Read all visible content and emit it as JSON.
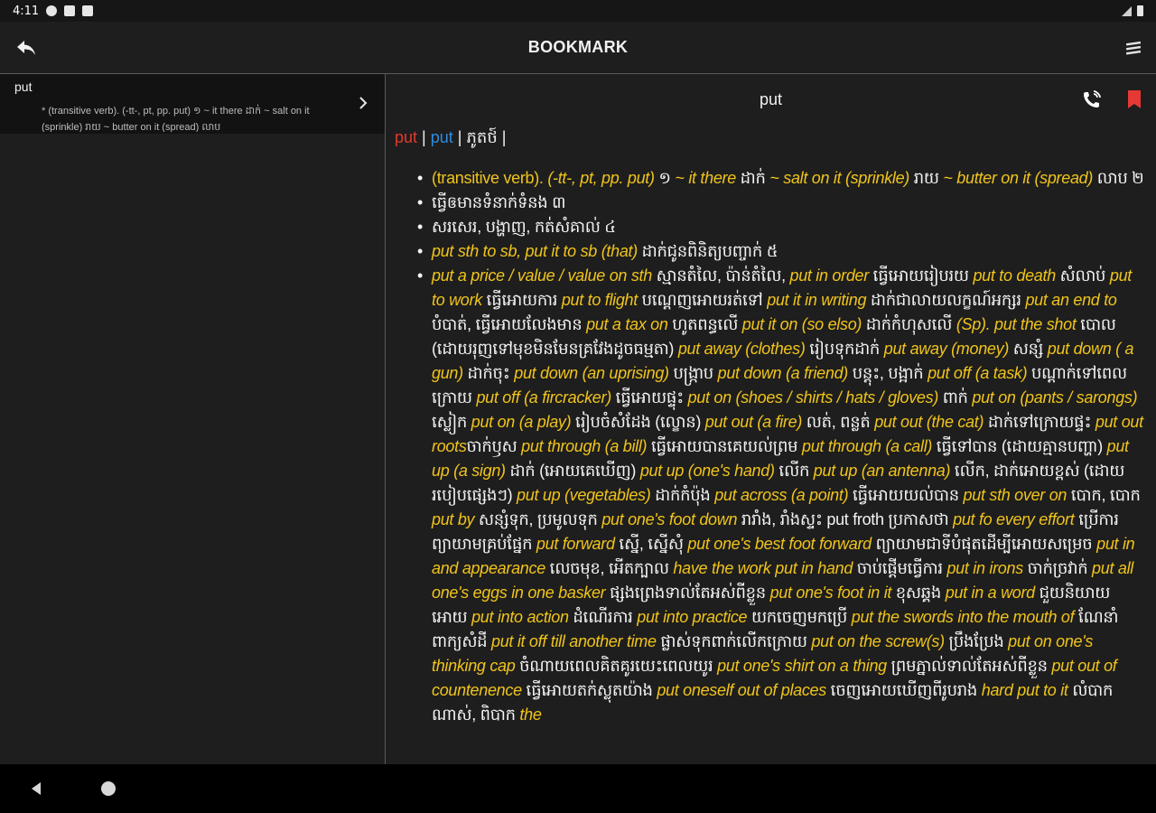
{
  "status_bar": {
    "time": "4:11",
    "icons": [
      "gear-icon",
      "square-icon",
      "sd-card-icon",
      "signal-icon",
      "battery-icon"
    ]
  },
  "app_bar": {
    "title": "BOOKMARK",
    "back_icon": "back-arrow-icon",
    "menu_icon": "menu-icon"
  },
  "bookmarks": [
    {
      "word": "put",
      "snippet": "* (transitive verb). (-tt-, pt, pp. put) ១ ~ it there ដាក់ ~ salt on it (sprinkle) រាយ ~ butter on it (spread) លាប"
    }
  ],
  "detail": {
    "word": "put",
    "headword_red": "put",
    "headword_blue": "put",
    "headword_khmer": "ភូតថ៍",
    "sep": "|",
    "definitions": [
      [
        {
          "t": "(transitive verb). ",
          "s": "en-plain"
        },
        {
          "t": "(-tt-, pt, pp. put)",
          "s": "en"
        },
        {
          "t": " ១ ",
          "s": "km"
        },
        {
          "t": "~ it there",
          "s": "en"
        },
        {
          "t": " ដាក់ ",
          "s": "km"
        },
        {
          "t": "~ salt on it (sprinkle)",
          "s": "en"
        },
        {
          "t": "  រាយ ",
          "s": "km"
        },
        {
          "t": "~ butter on it (spread)",
          "s": "en"
        },
        {
          "t": " លាប ២",
          "s": "km"
        }
      ],
      [
        {
          "t": "ធ្វើឲមានទំនាក់ទំនង ៣",
          "s": "km"
        }
      ],
      [
        {
          "t": "សរសេរ, បង្ហាញ, កត់សំគាល់ ៤",
          "s": "km"
        }
      ],
      [
        {
          "t": "put sth to sb, put it to sb (that)",
          "s": "en"
        },
        {
          "t": " ដាក់ជូនពិនិត្យបញ្ចាក់ ៥",
          "s": "km"
        }
      ],
      [
        {
          "t": "put a price / value /  value on sth",
          "s": "en"
        },
        {
          "t": " ស្មានតំលៃ, ប៉ាន់តំលៃ, ",
          "s": "km"
        },
        {
          "t": "put in order",
          "s": "en"
        },
        {
          "t": " ធ្វើអោយរៀបរយ ",
          "s": "km"
        },
        {
          "t": "put to death",
          "s": "en"
        },
        {
          "t": " សំលាប់ ",
          "s": "km"
        },
        {
          "t": "put to work",
          "s": "en"
        },
        {
          "t": " ធ្វើអោយការ ",
          "s": "km"
        },
        {
          "t": "put to flight",
          "s": "en"
        },
        {
          "t": " បណ្តេញអោយរត់ទៅ ",
          "s": "km"
        },
        {
          "t": "put it in writing",
          "s": "en"
        },
        {
          "t": " ដាក់ជាលាយលក្ខណ៍អក្សរ ",
          "s": "km"
        },
        {
          "t": "put an end to",
          "s": "en"
        },
        {
          "t": " បំបាត់, ធ្វើអោយលែងមាន ",
          "s": "km"
        },
        {
          "t": "put a tax on",
          "s": "en"
        },
        {
          "t": " ហូតពន្ធលើ ",
          "s": "km"
        },
        {
          "t": "put it on (so elso)",
          "s": "en"
        },
        {
          "t": " ដាក់កំហុសលើ ",
          "s": "km"
        },
        {
          "t": "(Sp). put the shot",
          "s": "en"
        },
        {
          "t": " បោល (ដោយរុញទៅមុខមិនមែនគ្រវែងដូចធម្មតា) ",
          "s": "km"
        },
        {
          "t": "put away (clothes)",
          "s": "en"
        },
        {
          "t": " រៀបទុកដាក់ ",
          "s": "km"
        },
        {
          "t": "put away (money)",
          "s": "en"
        },
        {
          "t": " សន្សំ ",
          "s": "km"
        },
        {
          "t": "put down ( a gun)",
          "s": "en"
        },
        {
          "t": " ដាក់ចុះ ",
          "s": "km"
        },
        {
          "t": "put down (an uprising)",
          "s": "en"
        },
        {
          "t": " បង្ក្រាប ",
          "s": "km"
        },
        {
          "t": "put down (a friend)",
          "s": "en"
        },
        {
          "t": " បន្តុះ, បង្អាក់ ",
          "s": "km"
        },
        {
          "t": "put off (a task)",
          "s": "en"
        },
        {
          "t": " បណ្តាក់ទៅពេលក្រោយ ",
          "s": "km"
        },
        {
          "t": "put off (a fircracker)",
          "s": "en"
        },
        {
          "t": " ធ្វើអោយផ្ទុះ ",
          "s": "km"
        },
        {
          "t": "put on (shoes / shirts / hats / gloves)",
          "s": "en"
        },
        {
          "t": " ពាក់ ",
          "s": "km"
        },
        {
          "t": "put on (pants / sarongs)",
          "s": "en"
        },
        {
          "t": " ស្លៀក ",
          "s": "km"
        },
        {
          "t": "put on (a play)",
          "s": "en"
        },
        {
          "t": " រៀបចំសំដែង (ល្ខោន) ",
          "s": "km"
        },
        {
          "t": "put out (a fire)",
          "s": "en"
        },
        {
          "t": " លត់, ពន្លត់ ",
          "s": "km"
        },
        {
          "t": "put out (the cat)",
          "s": "en"
        },
        {
          "t": " ដាក់ទៅក្រោយផ្ទះ ",
          "s": "km"
        },
        {
          "t": "put out roots",
          "s": "en"
        },
        {
          "t": "ចាក់ឫស ",
          "s": "km"
        },
        {
          "t": "put through (a bill)",
          "s": "en"
        },
        {
          "t": " ធ្វើអោយបានគេយល់ព្រម ",
          "s": "km"
        },
        {
          "t": "put through (a call)",
          "s": "en"
        },
        {
          "t": " ធ្វើទៅបាន (ដោយគ្មានបញ្ហា) ",
          "s": "km"
        },
        {
          "t": "put up (a sign)",
          "s": "en"
        },
        {
          "t": " ដាក់ (អោយគេឃើញ) ",
          "s": "km"
        },
        {
          "t": "put up (one's hand)",
          "s": "en"
        },
        {
          "t": " លើក ",
          "s": "km"
        },
        {
          "t": "put up (an antenna)",
          "s": "en"
        },
        {
          "t": " លើក, ដាក់អោយខ្ពស់ (ដោយរបៀបផ្សេងៗ) ",
          "s": "km"
        },
        {
          "t": "put up (vegetables)",
          "s": "en"
        },
        {
          "t": " ដាក់កំប៉ុង ",
          "s": "km"
        },
        {
          "t": "put across (a point)",
          "s": "en"
        },
        {
          "t": " ធ្វើអោយយល់បាន ",
          "s": "km"
        },
        {
          "t": "put sth over on",
          "s": "en"
        },
        {
          "t": " បោក, បោក ",
          "s": "km"
        },
        {
          "t": "put by",
          "s": "en"
        },
        {
          "t": " សន្សំទុក, ប្រមូលទុក ",
          "s": "km"
        },
        {
          "t": "put one's foot down",
          "s": "en"
        },
        {
          "t": " រារាំង, រាំងស្ទះ put froth ប្រកាសថា ",
          "s": "km"
        },
        {
          "t": "put fo every effort",
          "s": "en"
        },
        {
          "t": " ប្រើការព្យាយាមគ្រប់ផ្នែក ",
          "s": "km"
        },
        {
          "t": "put forward",
          "s": "en"
        },
        {
          "t": " ស្នើ, ស្នើសុំ ",
          "s": "km"
        },
        {
          "t": "put one's best foot forward",
          "s": "en"
        },
        {
          "t": " ព្យាយាមជាទីបំផុតដើម្បីអោយសម្រេច ",
          "s": "km"
        },
        {
          "t": "put in and appearance",
          "s": "en"
        },
        {
          "t": " លេចមុខ, អើតក្បាល ",
          "s": "km"
        },
        {
          "t": "have the work put in hand",
          "s": "en"
        },
        {
          "t": " ចាប់ផ្តើមធ្វើការ ",
          "s": "km"
        },
        {
          "t": "put in irons",
          "s": "en"
        },
        {
          "t": " ចាក់ច្រវាក់ ",
          "s": "km"
        },
        {
          "t": "put all one's eggs in one basker",
          "s": "en"
        },
        {
          "t": " ផ្សងព្រេងទាល់តែអស់ពីខ្លួន ",
          "s": "km"
        },
        {
          "t": "put one's foot in it",
          "s": "en"
        },
        {
          "t": " ខុសឆ្គង ",
          "s": "km"
        },
        {
          "t": "put in a word",
          "s": "en"
        },
        {
          "t": " ជួយនិយាយអោយ ",
          "s": "km"
        },
        {
          "t": "put into action",
          "s": "en"
        },
        {
          "t": " ដំណើរការ ",
          "s": "km"
        },
        {
          "t": "put into practice",
          "s": "en"
        },
        {
          "t": " យកចេញមកប្រើ ",
          "s": "km"
        },
        {
          "t": "put the swords into the mouth of",
          "s": "en"
        },
        {
          "t": " ណែនាំពាក្យសំដី ",
          "s": "km"
        },
        {
          "t": "put it off till another time",
          "s": "en"
        },
        {
          "t": " ផ្លាស់ទុកពាក់លើកក្រោយ ",
          "s": "km"
        },
        {
          "t": "put on the screw(s)",
          "s": "en"
        },
        {
          "t": " ប្រឹងប្រែង ",
          "s": "km"
        },
        {
          "t": "put on one's thinking cap",
          "s": "en"
        },
        {
          "t": " ចំណាយពេលគិតគូរយេះពេលយូរ ",
          "s": "km"
        },
        {
          "t": "put one's shirt on a thing",
          "s": "en"
        },
        {
          "t": " ព្រមភ្នាល់ទាល់តែអស់ពីខ្លួន ",
          "s": "km"
        },
        {
          "t": "put out of countenence",
          "s": "en"
        },
        {
          "t": " ធ្វើអោយតក់ស្លុតយ៉ាង ",
          "s": "km"
        },
        {
          "t": "put oneself out of places",
          "s": "en"
        },
        {
          "t": " ចេញអោយឃើញពីរូបរាង ",
          "s": "km"
        },
        {
          "t": "hard put to it",
          "s": "en"
        },
        {
          "t": " លំបាកណាស់, ពិបាក ",
          "s": "km"
        },
        {
          "t": "the",
          "s": "en"
        }
      ]
    ]
  },
  "colors": {
    "background": "#1e1e1e",
    "list_selected": "#121212",
    "english": "#f0c41b",
    "headword_red": "#e23a2e",
    "headword_blue": "#2b8ee0",
    "bookmark": "#e53935"
  },
  "nav_bar": {
    "back_icon": "triangle-back-icon",
    "home_icon": "circle-home-icon"
  }
}
